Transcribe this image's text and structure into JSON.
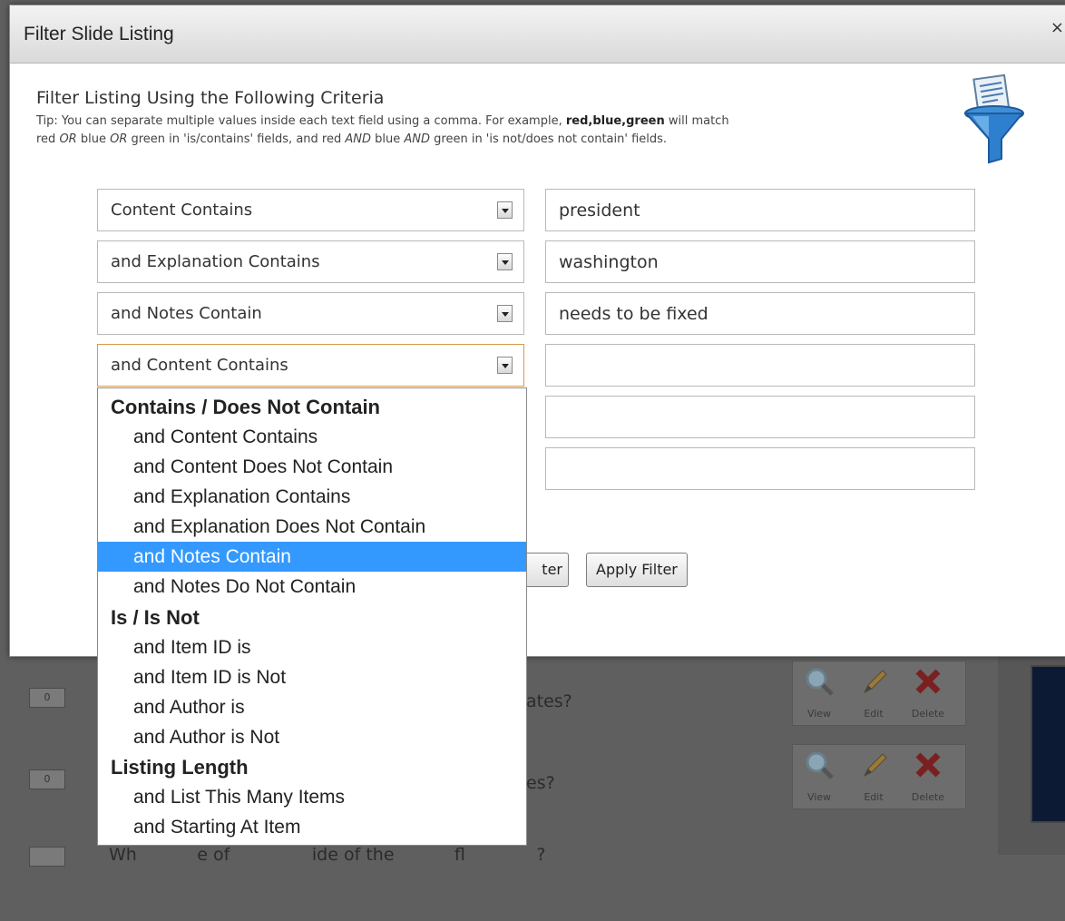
{
  "modal": {
    "title": "Filter Slide Listing",
    "close": "×",
    "heading": "Filter Listing Using the Following Criteria",
    "tip": {
      "line1_prefix": "Tip: You can separate multiple values inside each text field using a comma. For example, ",
      "example": "red,blue,green",
      "line1_suffix": " will match",
      "line2": [
        "red ",
        "OR",
        " blue ",
        "OR",
        " green in 'is/contains' fields, and red ",
        "AND",
        " blue ",
        "AND",
        " green in 'is not/does not contain' fields."
      ]
    }
  },
  "filters": [
    {
      "select": "Content Contains",
      "value": "president"
    },
    {
      "select": "and Explanation Contains",
      "value": "washington"
    },
    {
      "select": "and Notes Contain",
      "value": "needs to be fixed"
    },
    {
      "select": "and Content Contains",
      "value": ""
    },
    {
      "select": "",
      "value": ""
    },
    {
      "select": "",
      "value": ""
    }
  ],
  "buttons": {
    "clear_partial": "ter",
    "apply": "Apply Filter"
  },
  "dropdown": {
    "groups": [
      {
        "label": "Contains / Does Not Contain",
        "items": [
          "and Content Contains",
          "and Content Does Not Contain",
          "and Explanation Contains",
          "and Explanation Does Not Contain",
          "and Notes Contain",
          "and Notes Do Not Contain"
        ]
      },
      {
        "label": "Is / Is Not",
        "items": [
          "and Item ID is",
          "and Item ID is Not",
          "and Author is",
          "and Author is Not"
        ]
      },
      {
        "label": "Listing Length",
        "items": [
          "and List This Many Items",
          "and Starting At Item"
        ]
      }
    ],
    "selected": "and Notes Contain"
  },
  "background": {
    "rows": [
      {
        "count": "0",
        "question_fragment": "ates?"
      },
      {
        "count": "0",
        "question_fragment": "es?"
      }
    ],
    "third_row_fragment": "Wh           e of               ide of the           fl             ?",
    "actions": {
      "view": "View",
      "edit": "Edit",
      "delete": "Delete"
    }
  },
  "colors": {
    "selected": "#3399ff",
    "delete_icon": "#cc1f1f",
    "focus_border": "#d89a46"
  }
}
